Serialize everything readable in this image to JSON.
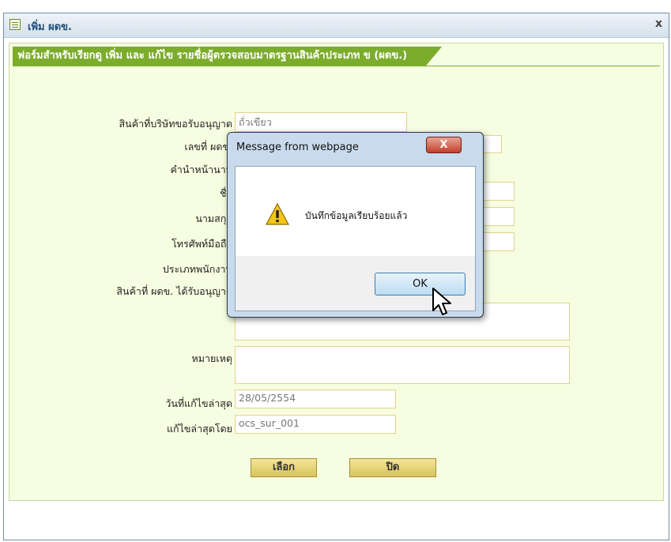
{
  "dialog": {
    "title": "เพิ่ม ผดข.",
    "close_label": "x"
  },
  "form": {
    "header": "ฟอร์มสำหรับเรียกดู เพิ่ม และ แก้ไข รายชื่อผู้ตรวจสอบมาตรฐานสินค้าประเภท ข (ผดข.)",
    "fields": {
      "product_label": "สินค้าที่บริษัทขอรับอนุญาต",
      "product_value": "ถั่วเขียว",
      "number_label": "เลขที่ ผดข.",
      "prefix_label": "คำนำหน้านาม",
      "firstname_label": "ชื่อ",
      "lastname_label": "นามสกุล",
      "mobile_label": "โทรศัพท์มือถือ",
      "staff_type_label": "ประเภทพนักงาน",
      "licensed_products_label": "สินค้าที่ ผดข. ได้รับอนุญาต",
      "remark_label": "หมายเหตุ",
      "last_modified_label": "วันที่แก้ไขล่าสุด",
      "last_modified_value": "28/05/2554",
      "modified_by_label": "แก้ไขล่าสุดโดย",
      "modified_by_value": "ocs_sur_001"
    },
    "buttons": {
      "select": "เลือก",
      "close": "ปิด"
    }
  },
  "message_box": {
    "title": "Message from webpage",
    "close_label": "X",
    "message": "บันทึกข้อมูลเรียบร้อยแล้ว",
    "ok_label": "OK",
    "icon": "warning-icon"
  },
  "colors": {
    "form_background": "#f6fde0",
    "header_green": "#7cac2c",
    "button_gold": "#d9c45c",
    "dialog_title": "#1f4f7a"
  }
}
